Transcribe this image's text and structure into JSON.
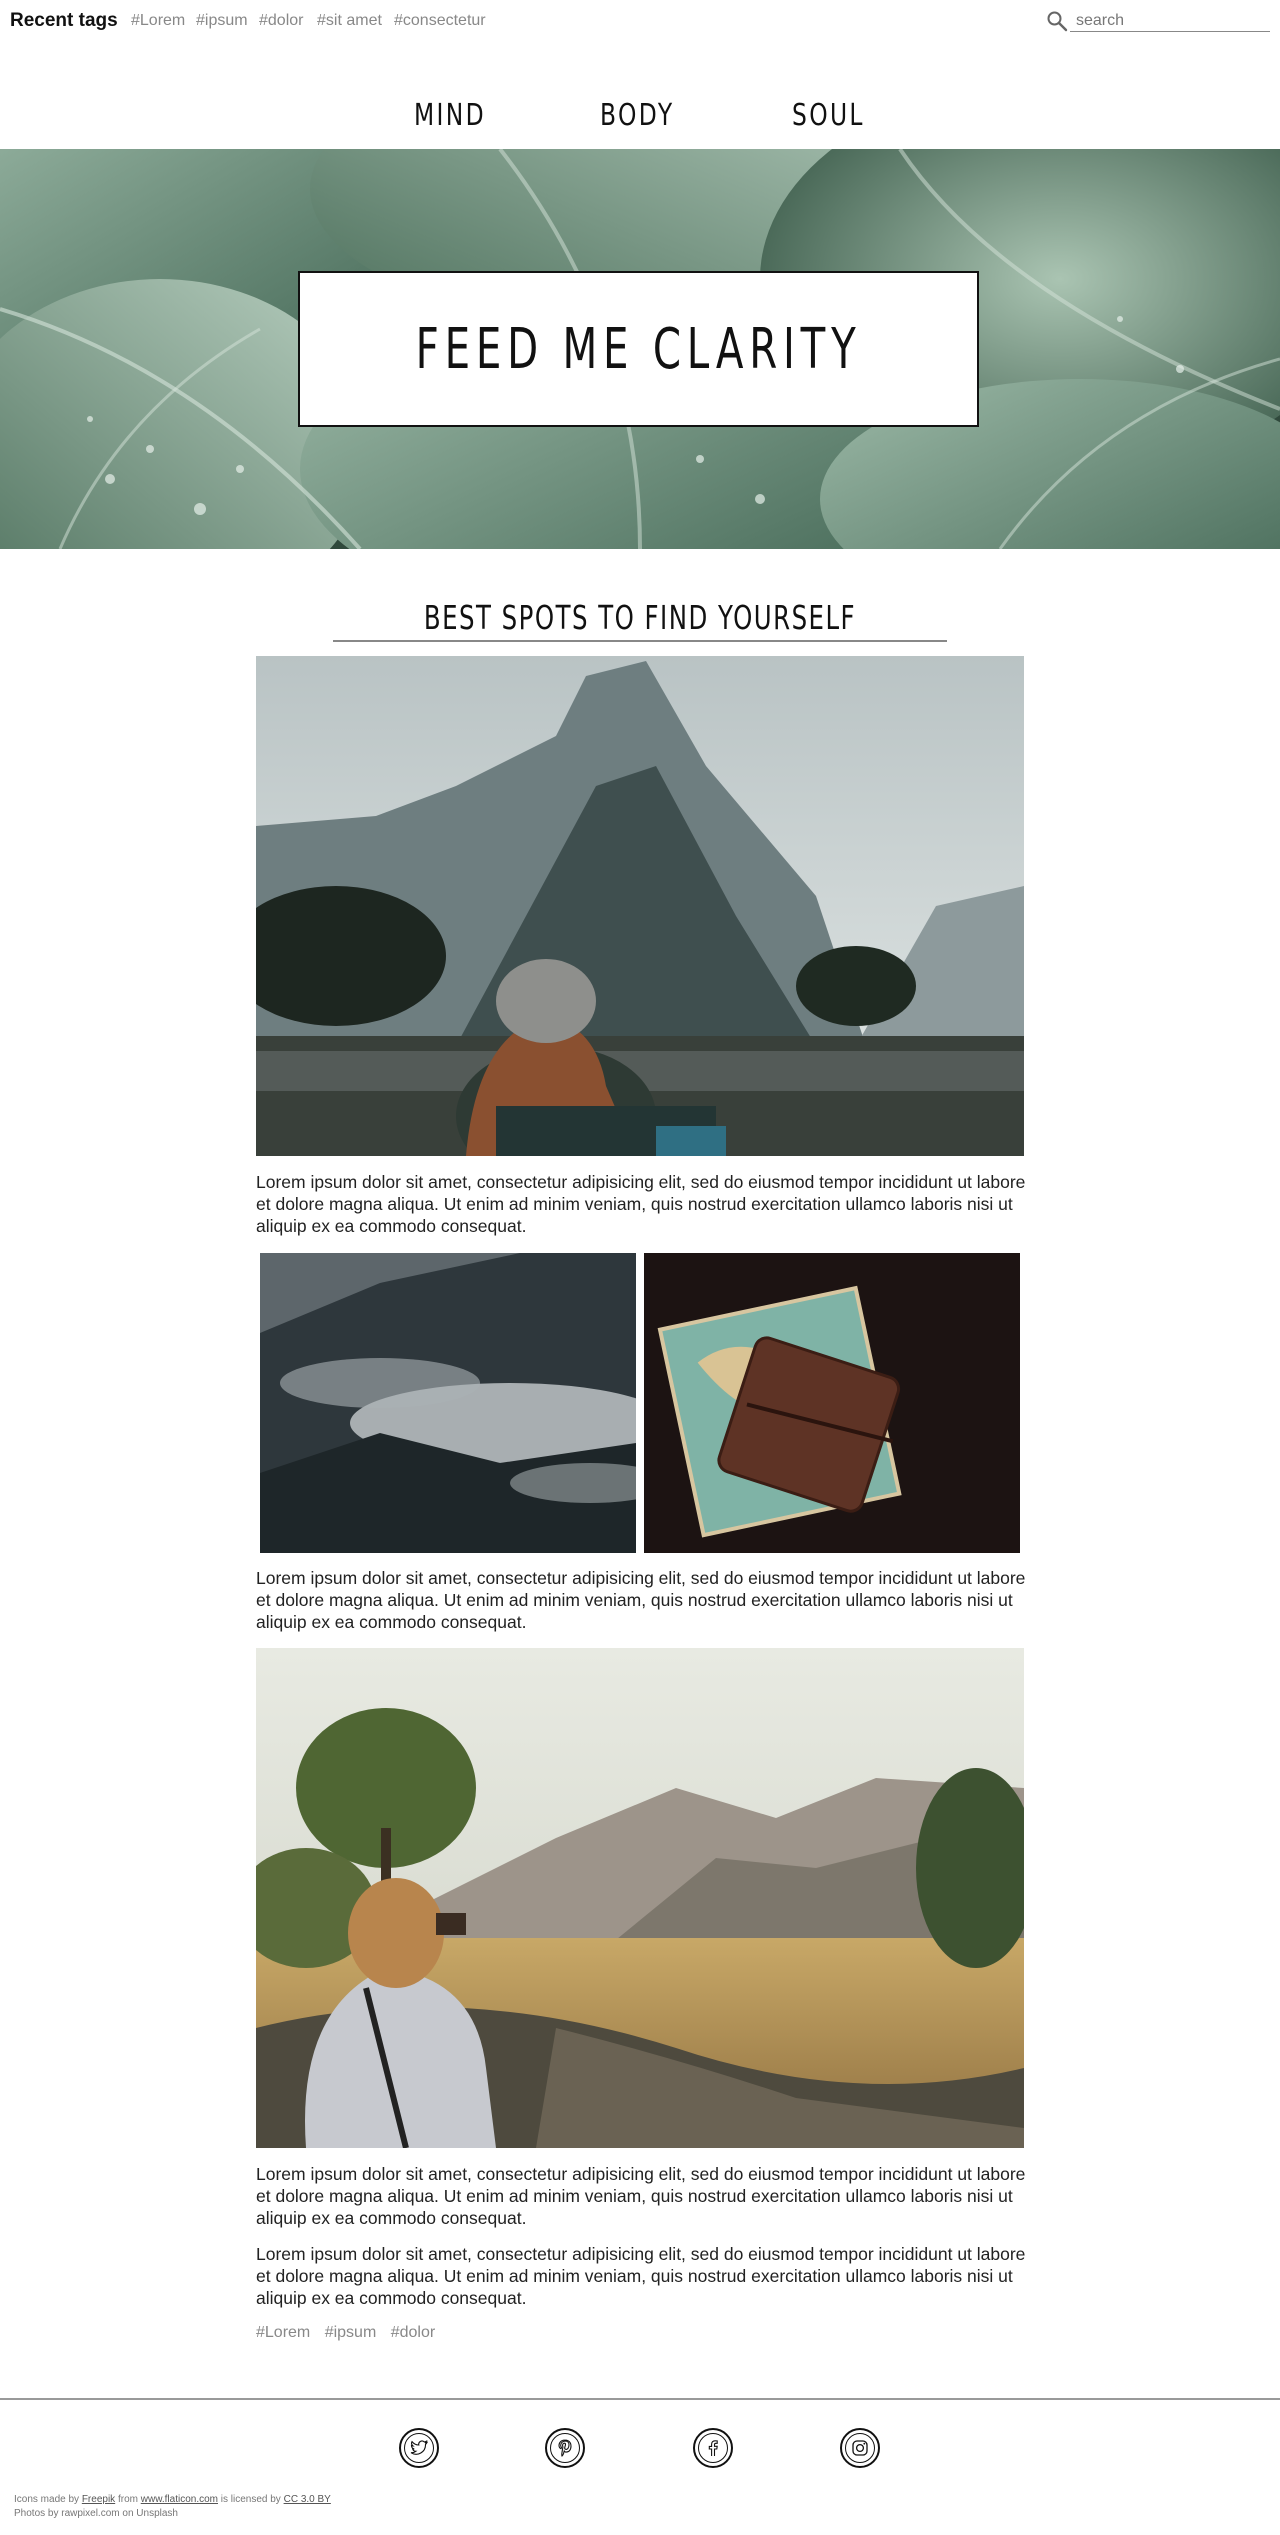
{
  "topbar": {
    "title": "Recent tags",
    "tags": [
      "#Lorem",
      "#ipsum",
      "#dolor",
      "#sit amet",
      "#consectetur"
    ],
    "search_placeholder": "search"
  },
  "nav": {
    "items": [
      "MIND",
      "BODY",
      "SOUL"
    ]
  },
  "hero": {
    "title": "FEED ME CLARITY"
  },
  "section": {
    "heading": "BEST SPOTS TO FIND YOURSELF"
  },
  "paragraphs": [
    "Lorem ipsum dolor sit amet, consectetur adipisicing elit, sed do eiusmod tempor incididunt ut labore et dolore magna aliqua. Ut enim ad minim veniam, quis nostrud exercitation ullamco laboris nisi ut aliquip ex ea commodo consequat.",
    "Lorem ipsum dolor sit amet, consectetur adipisicing elit, sed do eiusmod tempor incididunt ut labore et dolore magna aliqua. Ut enim ad minim veniam, quis nostrud exercitation ullamco laboris nisi ut aliquip ex ea commodo consequat.",
    "Lorem ipsum dolor sit amet, consectetur adipisicing elit, sed do eiusmod tempor incididunt ut labore et dolore magna aliqua. Ut enim ad minim veniam, quis nostrud exercitation ullamco laboris nisi ut aliquip ex ea commodo consequat.",
    "Lorem ipsum dolor sit amet, consectetur adipisicing elit, sed do eiusmod tempor incididunt ut labore et dolore magna aliqua. Ut enim ad minim veniam, quis nostrud exercitation ullamco laboris nisi ut aliquip ex ea commodo consequat."
  ],
  "post_tags": [
    "#Lorem",
    "#ipsum",
    "#dolor"
  ],
  "footer": {
    "social": [
      "twitter-icon",
      "pinterest-icon",
      "facebook-icon",
      "instagram-icon"
    ],
    "credit1_prefix": "Icons made by",
    "credit1_author": "Freepik",
    "credit1_from": "from",
    "credit1_site": "www.flaticon.com",
    "credit1_licensed": "is licensed by",
    "credit1_license": "CC 3.0 BY",
    "credit2": "Photos by rawpixel.com on Unsplash"
  },
  "colors": {
    "text": "#111111",
    "muted": "#888888",
    "leaf_dark": "#3f5f4c",
    "leaf_light": "#8fae9a"
  }
}
